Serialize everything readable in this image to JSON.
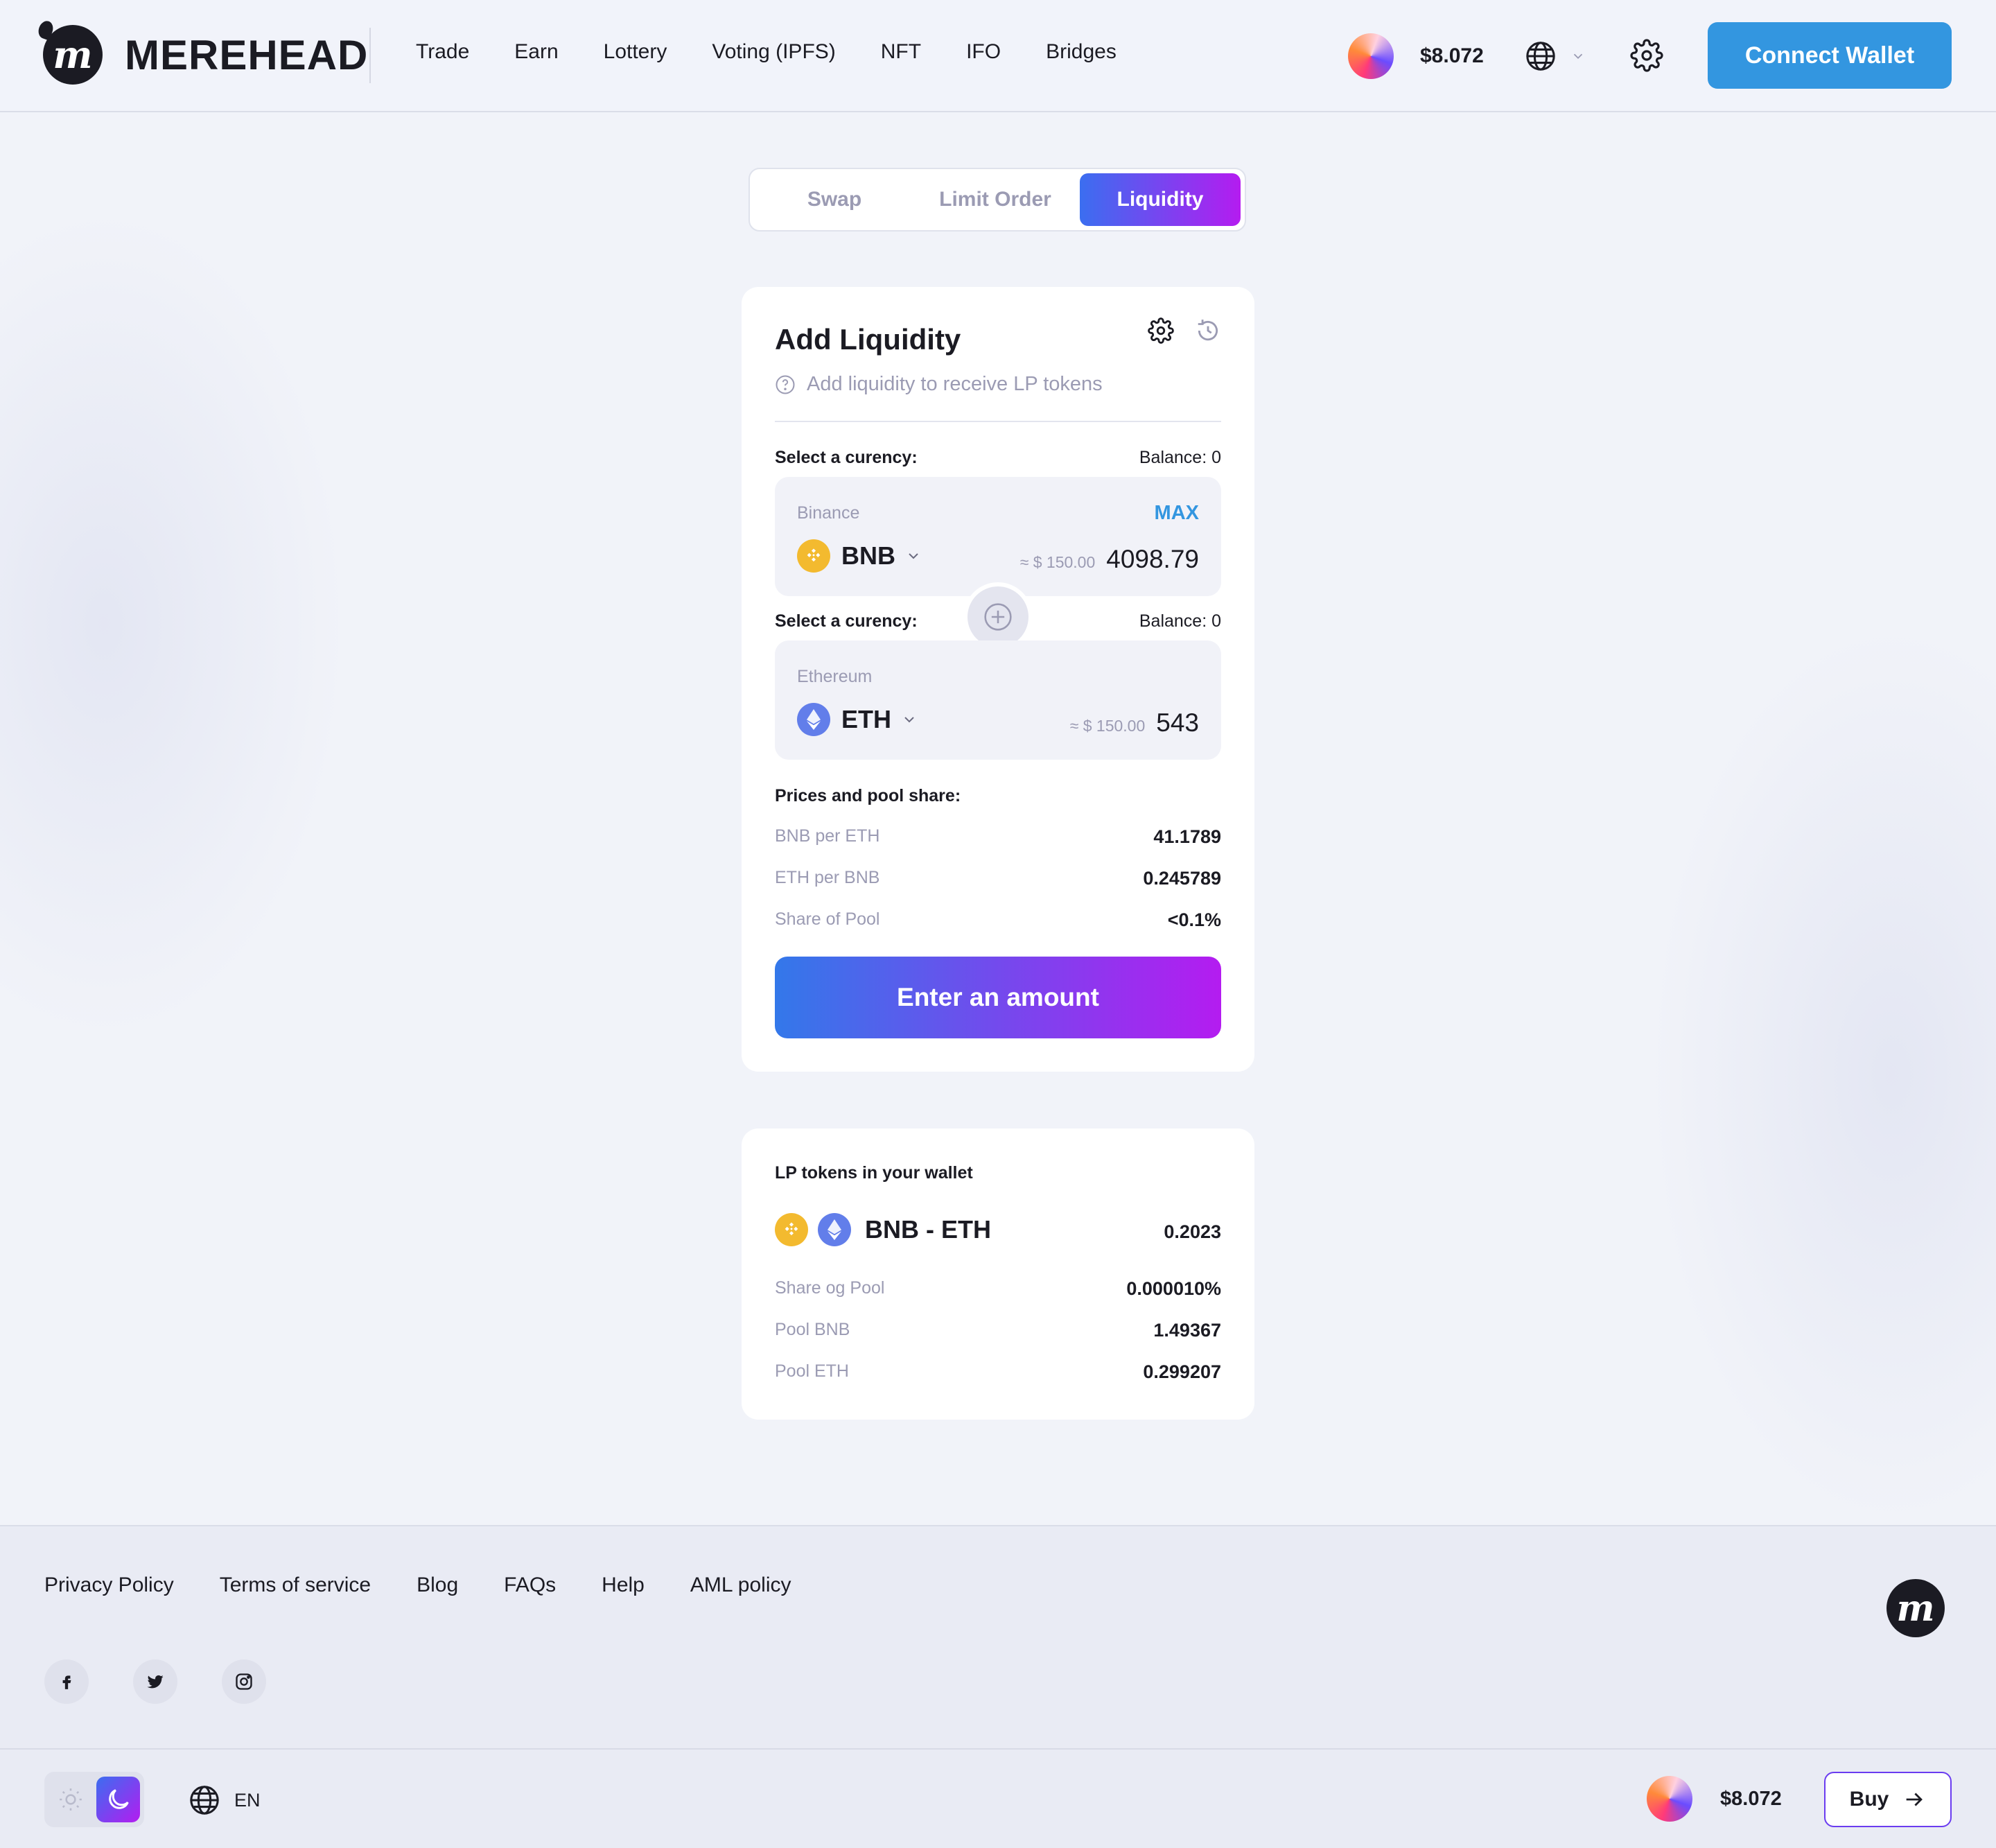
{
  "header": {
    "brand": "MEREHEAD",
    "nav": [
      "Trade",
      "Earn",
      "Lottery",
      "Voting (IPFS)",
      "NFT",
      "IFO",
      "Bridges"
    ],
    "price": "$8.072",
    "connect_label": "Connect Wallet"
  },
  "tabs": [
    "Swap",
    "Limit Order",
    "Liquidity"
  ],
  "active_tab": "Liquidity",
  "card": {
    "title": "Add Liquidity",
    "subtitle": "Add liquidity to receive LP tokens",
    "currency1": {
      "label": "Select a curency:",
      "balance": "Balance: 0",
      "network": "Binance",
      "max": "MAX",
      "symbol": "BNB",
      "usd": "≈ $ 150.00",
      "amount": "4098.79"
    },
    "currency2": {
      "label": "Select a curency:",
      "balance": "Balance: 0",
      "network": "Ethereum",
      "symbol": "ETH",
      "usd": "≈ $ 150.00",
      "amount": "543"
    },
    "prices_title": "Prices and pool share:",
    "prices": [
      {
        "k": "BNB per ETH",
        "v": "41.1789"
      },
      {
        "k": "ETH per BNB",
        "v": "0.245789"
      },
      {
        "k": "Share of Pool",
        "v": "<0.1%"
      }
    ],
    "cta": "Enter an amount"
  },
  "lp": {
    "title": "LP tokens in your wallet",
    "pair": "BNB - ETH",
    "balance": "0.2023",
    "rows": [
      {
        "k": "Share og Pool",
        "v": "0.000010%"
      },
      {
        "k": "Pool BNB",
        "v": "1.49367"
      },
      {
        "k": "Pool ETH",
        "v": "0.299207"
      }
    ]
  },
  "footer": {
    "links": [
      "Privacy Policy",
      "Terms of service",
      "Blog",
      "FAQs",
      "Help",
      "AML policy"
    ],
    "lang": "EN",
    "price": "$8.072",
    "buy": "Buy"
  },
  "colors": {
    "accent": "#3396e0",
    "gradient_start": "#3b6ef0",
    "gradient_end": "#b41cf0",
    "bnb": "#f3ba2f",
    "eth": "#627eea"
  }
}
